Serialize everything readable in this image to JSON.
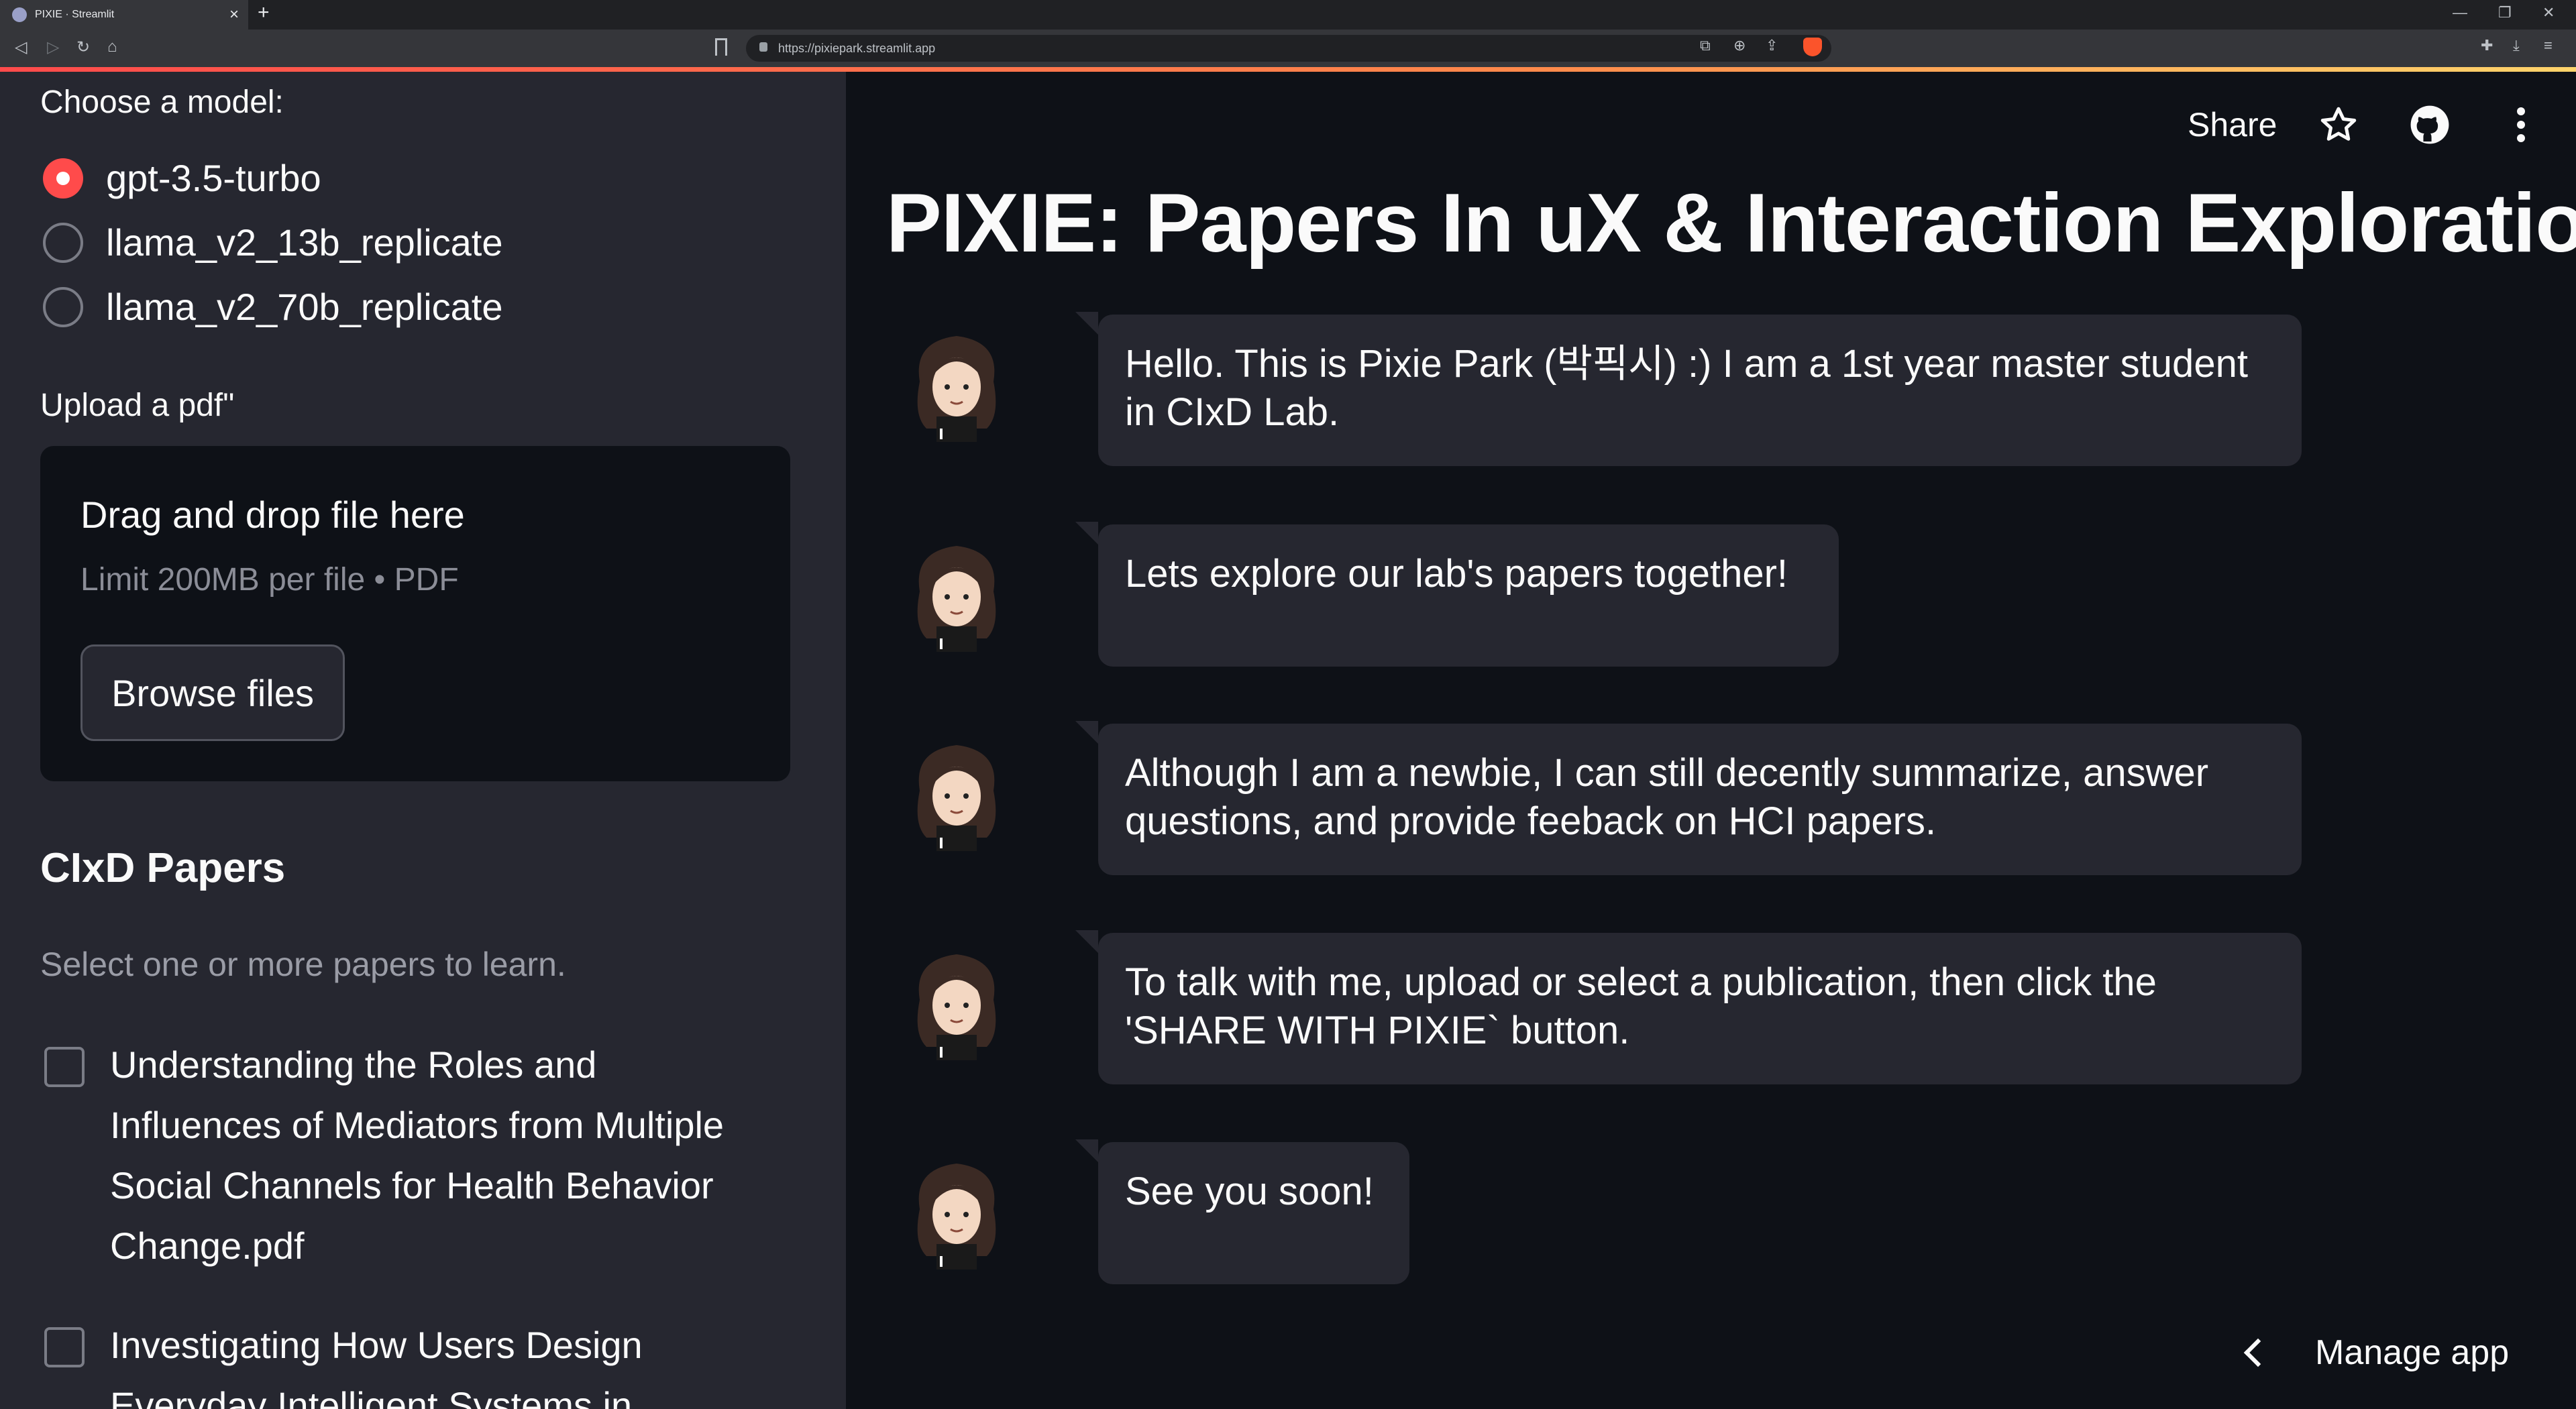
{
  "browser": {
    "tab_title": "PIXIE · Streamlit",
    "url": "https://pixiepark.streamlit.app"
  },
  "sidebar": {
    "model_label": "Choose a model:",
    "models": [
      {
        "label": "gpt-3.5-turbo",
        "selected": true
      },
      {
        "label": "llama_v2_13b_replicate",
        "selected": false
      },
      {
        "label": "llama_v2_70b_replicate",
        "selected": false
      }
    ],
    "upload_label": "Upload a pdf\"",
    "dropzone": {
      "title": "Drag and drop file here",
      "limit": "Limit 200MB per file • PDF",
      "browse_label": "Browse files"
    },
    "papers_heading": "CIxD Papers",
    "papers_caption": "Select one or more papers to learn.",
    "papers": [
      {
        "label": "Understanding the Roles and Influences of Mediators from Multiple Social Channels for Health Behavior Change.pdf",
        "checked": false
      },
      {
        "label": "Investigating How Users Design Everyday Intelligent Systems in",
        "checked": false
      }
    ]
  },
  "header": {
    "share_label": "Share",
    "icons": [
      "star-icon",
      "github-icon",
      "more-vertical-icon"
    ]
  },
  "main": {
    "title": "PIXIE: Papers In uX & Interaction Exploration",
    "messages": [
      {
        "text": "Hello. This is Pixie Park (박픽시) :) I am a 1st year master student in CIxD Lab."
      },
      {
        "text": "Lets explore our lab's papers together!"
      },
      {
        "text": "Although I am a newbie, I can still decently summarize, answer questions, and provide feeback on HCI papers."
      },
      {
        "text": "To talk with me, upload or select a publication, then click the 'SHARE WITH PIXIE` button."
      },
      {
        "text": "See you soon!"
      }
    ],
    "manage_label": "Manage app"
  },
  "colors": {
    "accent": "#ff4b4b",
    "sidebar_bg": "#262730",
    "main_bg": "#0e1117",
    "bubble_bg": "#262730"
  }
}
